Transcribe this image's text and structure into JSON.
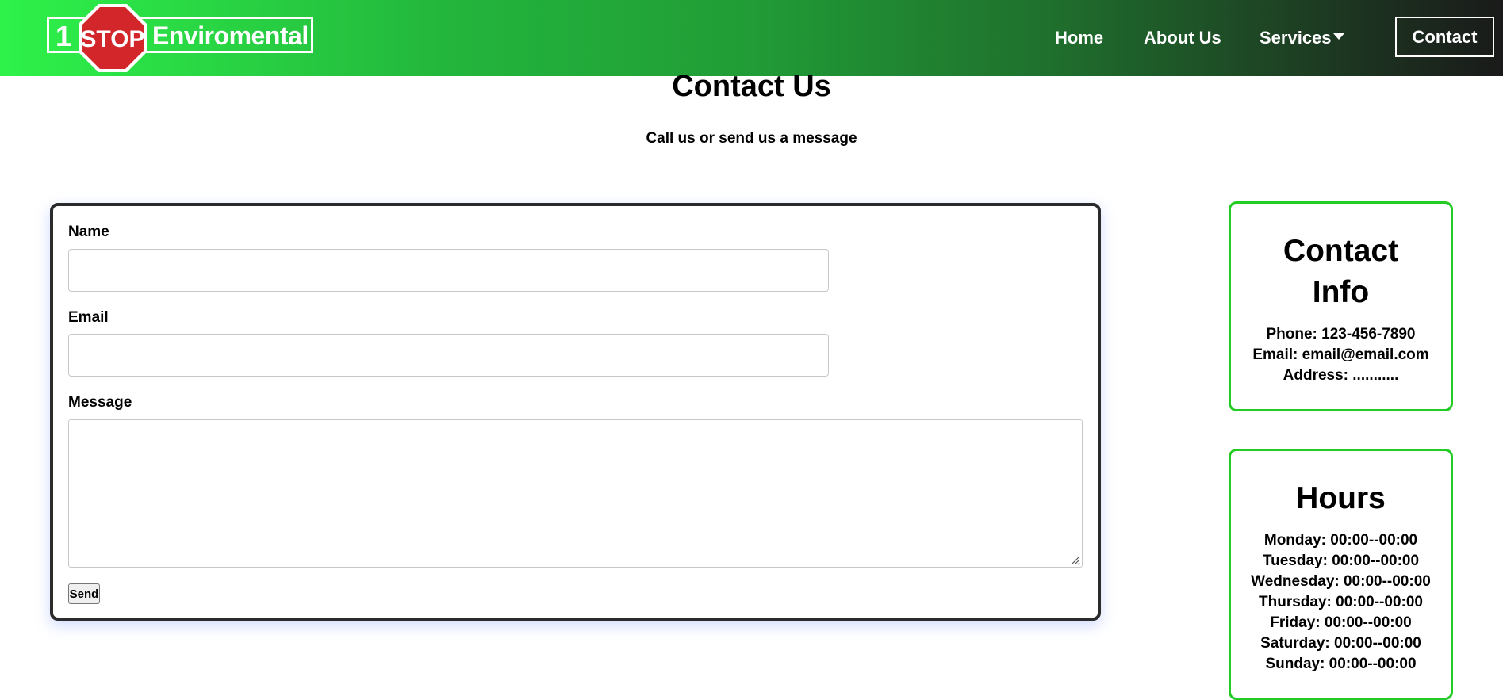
{
  "header": {
    "logo": {
      "number": "1",
      "stop_text": "STOP",
      "brand": "Enviromental"
    },
    "nav": {
      "home": "Home",
      "about": "About Us",
      "services": "Services",
      "contact": "Contact"
    }
  },
  "page": {
    "title": "Contact Us",
    "subtitle": "Call us or send us a message"
  },
  "form": {
    "name_label": "Name",
    "name_value": "",
    "email_label": "Email",
    "email_value": "",
    "message_label": "Message",
    "message_value": "",
    "send_label": "Send"
  },
  "contact_info": {
    "title": "Contact Info",
    "phone": "Phone: 123-456-7890",
    "email": "Email: email@email.com",
    "address": "Address: ..........."
  },
  "hours": {
    "title": "Hours",
    "days": [
      "Monday: 00:00--00:00",
      "Tuesday: 00:00--00:00",
      "Wednesday: 00:00--00:00",
      "Thursday: 00:00--00:00",
      "Friday: 00:00--00:00",
      "Saturday: 00:00--00:00",
      "Sunday: 00:00--00:00"
    ]
  },
  "colors": {
    "header_start": "#2ef24a",
    "header_end": "#1a1a1a",
    "card_border": "#22cc22",
    "stop_red": "#d3262b"
  }
}
